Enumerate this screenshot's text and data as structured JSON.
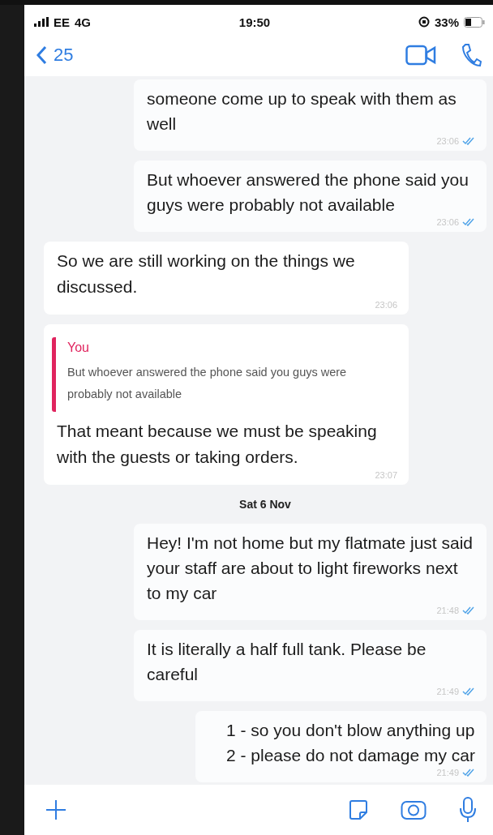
{
  "status_bar": {
    "carrier": "EE",
    "network": "4G",
    "time": "19:50",
    "battery": "33%"
  },
  "header": {
    "back_count": "25"
  },
  "messages": [
    {
      "kind": "outgoing",
      "text": "someone come up to speak with them as well",
      "time": "23:06",
      "read": true
    },
    {
      "kind": "outgoing",
      "text": "But whoever answered the phone said you guys were probably not available",
      "time": "23:06",
      "read": true
    },
    {
      "kind": "incoming",
      "text": "So we are still working on the things we discussed.",
      "time": "23:06"
    },
    {
      "kind": "incoming",
      "quote": {
        "author": "You",
        "text": "But whoever answered the phone said you guys were probably not available"
      },
      "text": "That meant because we must be speaking with the guests or taking orders.",
      "time": "23:07"
    },
    {
      "kind": "date",
      "text": "Sat 6 Nov"
    },
    {
      "kind": "outgoing",
      "text": "Hey! I'm not home but my flatmate just said your staff are about to light fireworks next to my car",
      "time": "21:48",
      "read": true
    },
    {
      "kind": "outgoing",
      "text": "It is literally a half full tank. Please be careful",
      "time": "21:49",
      "read": true
    },
    {
      "kind": "outgoing",
      "lines": [
        "1 - so you don't blow anything up",
        "2 - please do not damage my car"
      ],
      "time": "21:49",
      "read": true
    }
  ]
}
